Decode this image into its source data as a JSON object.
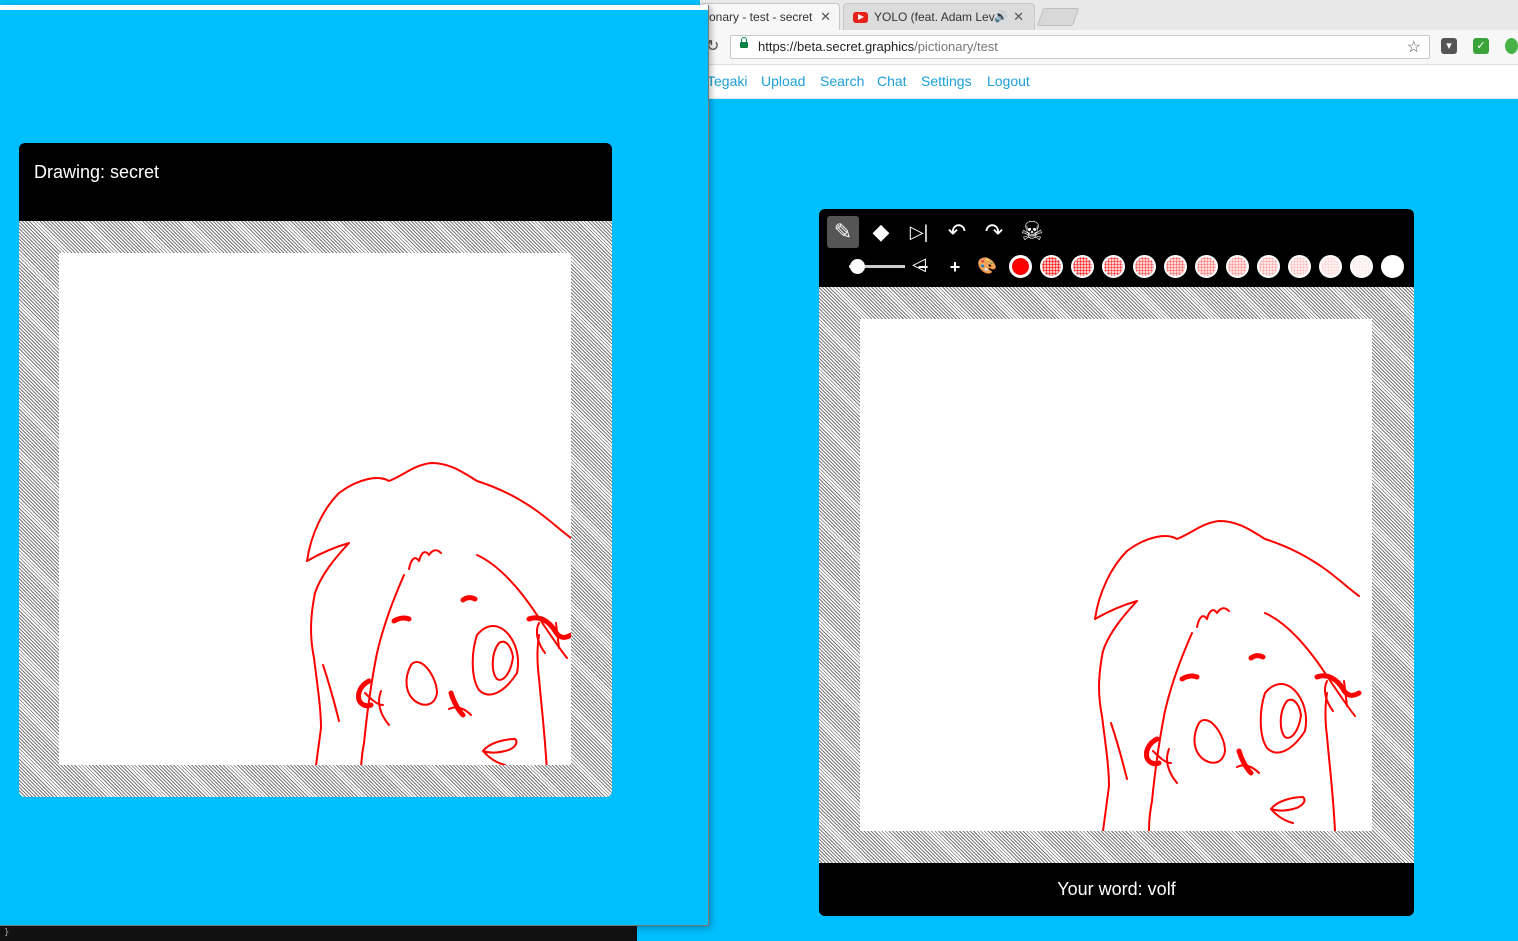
{
  "browser": {
    "tabs": [
      {
        "label": "onary - test - secret",
        "active": true
      },
      {
        "label": "YOLO (feat. Adam Lev",
        "active": false,
        "audio": true
      }
    ],
    "url_host": "https://beta.secret.graphics",
    "url_path": "/pictionary/test",
    "nav_links": [
      "Tegaki",
      "Upload",
      "Search",
      "Chat",
      "Settings",
      "Logout"
    ]
  },
  "left_window": {
    "header": "Drawing: secret"
  },
  "right_panel": {
    "tools": [
      "pencil-icon",
      "eraser-icon",
      "mirror-icon",
      "undo-icon",
      "redo-icon",
      "skull-icon"
    ],
    "size_controls": [
      "−",
      "+"
    ],
    "palette_icon": "palette-icon",
    "brush_color": "#ff0000",
    "swatch_count": 13,
    "footer": "Your word: volf"
  },
  "bottom_strip": {
    "text": "}"
  },
  "colors": {
    "background": "#00bfff",
    "panel": "#000000",
    "link": "#1a9fd8",
    "ink": "#ff0000"
  }
}
